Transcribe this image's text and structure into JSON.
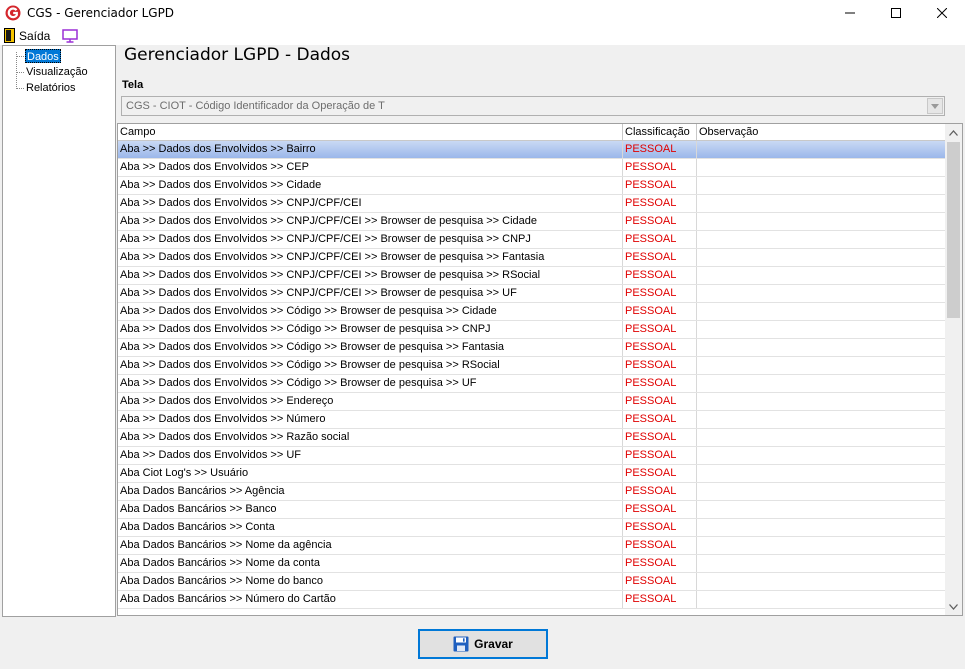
{
  "window": {
    "title": "CGS - Gerenciador LGPD"
  },
  "menu": {
    "exit_label": "Saída",
    "monitor_icon": "monitor-icon"
  },
  "sidebar": {
    "items": [
      {
        "label": "Dados",
        "selected": true
      },
      {
        "label": "Visualização",
        "selected": false
      },
      {
        "label": "Relatórios",
        "selected": false
      }
    ]
  },
  "main": {
    "title": "Gerenciador LGPD - Dados",
    "tela_label": "Tela",
    "tela_value": "CGS - CIOT - Código Identificador da Operação de T"
  },
  "grid": {
    "columns": [
      "Campo",
      "Classificação",
      "Observação"
    ],
    "rows": [
      {
        "campo": "Aba >> Dados dos Envolvidos >> Bairro",
        "classificacao": "PESSOAL",
        "observacao": ""
      },
      {
        "campo": "Aba >> Dados dos Envolvidos >> CEP",
        "classificacao": "PESSOAL",
        "observacao": ""
      },
      {
        "campo": "Aba >> Dados dos Envolvidos >> Cidade",
        "classificacao": "PESSOAL",
        "observacao": ""
      },
      {
        "campo": "Aba >> Dados dos Envolvidos >> CNPJ/CPF/CEI",
        "classificacao": "PESSOAL",
        "observacao": ""
      },
      {
        "campo": "Aba >> Dados dos Envolvidos >> CNPJ/CPF/CEI >> Browser de pesquisa >> Cidade",
        "classificacao": "PESSOAL",
        "observacao": ""
      },
      {
        "campo": "Aba >> Dados dos Envolvidos >> CNPJ/CPF/CEI >> Browser de pesquisa >> CNPJ",
        "classificacao": "PESSOAL",
        "observacao": ""
      },
      {
        "campo": "Aba >> Dados dos Envolvidos >> CNPJ/CPF/CEI >> Browser de pesquisa >> Fantasia",
        "classificacao": "PESSOAL",
        "observacao": ""
      },
      {
        "campo": "Aba >> Dados dos Envolvidos >> CNPJ/CPF/CEI >> Browser de pesquisa >> RSocial",
        "classificacao": "PESSOAL",
        "observacao": ""
      },
      {
        "campo": "Aba >> Dados dos Envolvidos >> CNPJ/CPF/CEI >> Browser de pesquisa >> UF",
        "classificacao": "PESSOAL",
        "observacao": ""
      },
      {
        "campo": "Aba >> Dados dos Envolvidos >> Código >> Browser de pesquisa >> Cidade",
        "classificacao": "PESSOAL",
        "observacao": ""
      },
      {
        "campo": "Aba >> Dados dos Envolvidos >> Código >> Browser de pesquisa >> CNPJ",
        "classificacao": "PESSOAL",
        "observacao": ""
      },
      {
        "campo": "Aba >> Dados dos Envolvidos >> Código >> Browser de pesquisa >> Fantasia",
        "classificacao": "PESSOAL",
        "observacao": ""
      },
      {
        "campo": "Aba >> Dados dos Envolvidos >> Código >> Browser de pesquisa >> RSocial",
        "classificacao": "PESSOAL",
        "observacao": ""
      },
      {
        "campo": "Aba >> Dados dos Envolvidos >> Código >> Browser de pesquisa >> UF",
        "classificacao": "PESSOAL",
        "observacao": ""
      },
      {
        "campo": "Aba >> Dados dos Envolvidos >> Endereço",
        "classificacao": "PESSOAL",
        "observacao": ""
      },
      {
        "campo": "Aba >> Dados dos Envolvidos >> Número",
        "classificacao": "PESSOAL",
        "observacao": ""
      },
      {
        "campo": "Aba >> Dados dos Envolvidos >> Razão social",
        "classificacao": "PESSOAL",
        "observacao": ""
      },
      {
        "campo": "Aba >> Dados dos Envolvidos >> UF",
        "classificacao": "PESSOAL",
        "observacao": ""
      },
      {
        "campo": "Aba Ciot Log's >> Usuário",
        "classificacao": "PESSOAL",
        "observacao": ""
      },
      {
        "campo": "Aba Dados Bancários >> Agência",
        "classificacao": "PESSOAL",
        "observacao": ""
      },
      {
        "campo": "Aba Dados Bancários >> Banco",
        "classificacao": "PESSOAL",
        "observacao": ""
      },
      {
        "campo": "Aba Dados Bancários >> Conta",
        "classificacao": "PESSOAL",
        "observacao": ""
      },
      {
        "campo": "Aba Dados Bancários >> Nome da agência",
        "classificacao": "PESSOAL",
        "observacao": ""
      },
      {
        "campo": "Aba Dados Bancários >> Nome da conta",
        "classificacao": "PESSOAL",
        "observacao": ""
      },
      {
        "campo": "Aba Dados Bancários >> Nome do banco",
        "classificacao": "PESSOAL",
        "observacao": ""
      },
      {
        "campo": "Aba Dados Bancários >> Número do Cartão",
        "classificacao": "PESSOAL",
        "observacao": ""
      }
    ]
  },
  "footer": {
    "save_label": "Gravar"
  },
  "colors": {
    "classification": "#e00000",
    "selection": "#0078d7",
    "save_icon": "#1f5fbf"
  }
}
